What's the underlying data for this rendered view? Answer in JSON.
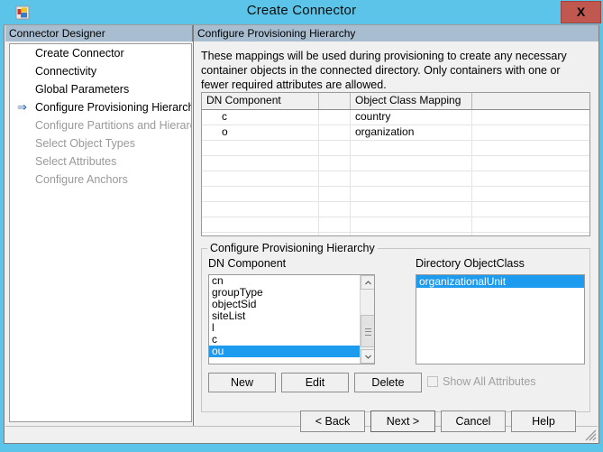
{
  "window": {
    "title": "Create Connector",
    "icon": "connector-icon",
    "close_label": "X"
  },
  "left_panel": {
    "header": "Connector Designer",
    "items": [
      {
        "label": "Create Connector",
        "state": "enabled",
        "current": false
      },
      {
        "label": "Connectivity",
        "state": "enabled",
        "current": false
      },
      {
        "label": "Global Parameters",
        "state": "enabled",
        "current": false
      },
      {
        "label": "Configure Provisioning Hierarchy",
        "state": "enabled",
        "current": true
      },
      {
        "label": "Configure Partitions and Hierarchies",
        "state": "disabled",
        "current": false
      },
      {
        "label": "Select Object Types",
        "state": "disabled",
        "current": false
      },
      {
        "label": "Select Attributes",
        "state": "disabled",
        "current": false
      },
      {
        "label": "Configure Anchors",
        "state": "disabled",
        "current": false
      }
    ],
    "current_arrow": "⇒"
  },
  "right_panel": {
    "header": "Configure Provisioning Hierarchy",
    "description": "These mappings will be used during provisioning to create any necessary container objects in the connected directory.  Only containers with one or fewer required attributes are allowed."
  },
  "grid": {
    "columns": [
      "DN Component",
      "",
      "Object Class Mapping",
      ""
    ],
    "rows": [
      {
        "dn": "c",
        "spacer": "",
        "mapping": "country",
        "extra": ""
      },
      {
        "dn": "o",
        "spacer": "",
        "mapping": "organization",
        "extra": ""
      }
    ],
    "empty_rows": 8
  },
  "groupbox": {
    "title": "Configure Provisioning Hierarchy",
    "dn_label": "DN Component",
    "objectclass_label": "Directory ObjectClass",
    "dn_items": [
      {
        "label": "cn",
        "selected": false
      },
      {
        "label": "groupType",
        "selected": false
      },
      {
        "label": "objectSid",
        "selected": false
      },
      {
        "label": "siteList",
        "selected": false
      },
      {
        "label": "l",
        "selected": false
      },
      {
        "label": "c",
        "selected": false
      },
      {
        "label": "ou",
        "selected": true
      }
    ],
    "objectclass_items": [
      {
        "label": "organizationalUnit",
        "selected": true
      }
    ],
    "buttons": {
      "new": "New",
      "edit": "Edit",
      "delete": "Delete"
    },
    "checkbox": {
      "label": "Show All Attributes",
      "checked": false,
      "enabled": false
    },
    "scrollbar": {
      "up_arrow": "▲",
      "down_arrow": "▼"
    }
  },
  "dialog_buttons": {
    "back": "< Back",
    "next": "Next  >",
    "cancel": "Cancel",
    "help": "Help",
    "default": "next"
  },
  "colors": {
    "title_bar": "#5BC4E8",
    "close_button": "#C1584F",
    "panel_header": "#A8BDD0",
    "selection": "#1C9BEF",
    "face": "#F0F0F0",
    "arrow": "#2C5FA8"
  }
}
